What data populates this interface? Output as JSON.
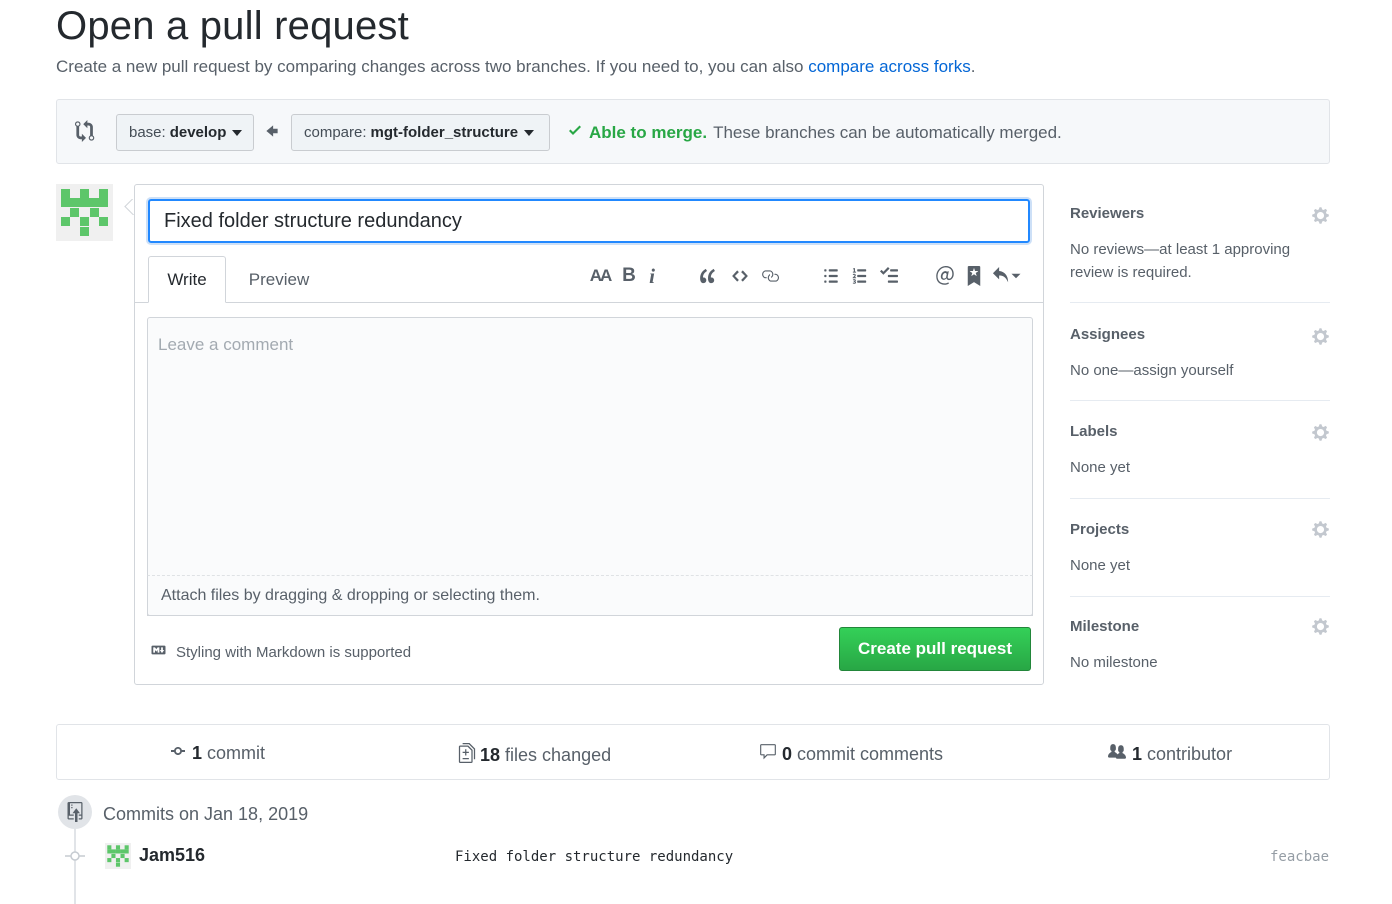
{
  "header": {
    "title": "Open a pull request",
    "subtitle": "Create a new pull request by comparing changes across two branches. If you need to, you can also ",
    "subtitle_link": "compare across forks",
    "subtitle_end": "."
  },
  "range": {
    "base_prefix": "base:",
    "base_branch": "develop",
    "compare_prefix": "compare:",
    "compare_branch": "mgt-folder_structure",
    "merge_ok": "Able to merge.",
    "merge_desc": "These branches can be automatically merged."
  },
  "composer": {
    "title_value": "Fixed folder structure redundancy",
    "tabs": [
      "Write",
      "Preview"
    ],
    "comment_placeholder": "Leave a comment",
    "attach_text": "Attach files by dragging & dropping or selecting them.",
    "markdown_note": "Styling with Markdown is supported",
    "create_button": "Create pull request",
    "toolbar": {
      "header_text": "AA",
      "bold_text": "B",
      "italic_text": "i"
    }
  },
  "sidebar": {
    "reviewers": {
      "heading": "Reviewers",
      "value": "No reviews—at least 1 approving review is required."
    },
    "assignees": {
      "heading": "Assignees",
      "value": "No one—assign yourself"
    },
    "labels": {
      "heading": "Labels",
      "value": "None yet"
    },
    "projects": {
      "heading": "Projects",
      "value": "None yet"
    },
    "milestone": {
      "heading": "Milestone",
      "value": "No milestone"
    }
  },
  "stats": {
    "commits_num": "1",
    "commits_label": "commit",
    "files_num": "18",
    "files_label": "files changed",
    "comments_num": "0",
    "comments_label": "commit comments",
    "contributors_num": "1",
    "contributors_label": "contributor"
  },
  "commits": {
    "date_heading": "Commits on Jan 18, 2019",
    "items": [
      {
        "author": "Jam516",
        "message": "Fixed folder structure redundancy",
        "sha": "feacbae"
      }
    ]
  },
  "colors": {
    "link": "#0366d6",
    "success": "#28a745",
    "focus": "#2188ff",
    "avatar_green": "#5dc66a"
  }
}
